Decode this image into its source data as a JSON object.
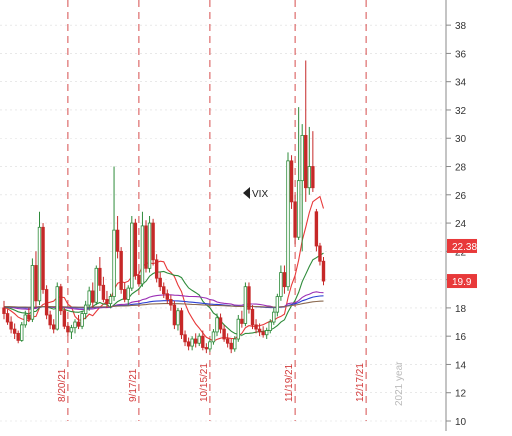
{
  "chart_data": {
    "type": "candlestick",
    "symbol": "VIX",
    "ylim": [
      10,
      39
    ],
    "y_ticks": [
      10,
      12,
      14,
      16,
      18,
      20,
      22,
      24,
      26,
      28,
      30,
      32,
      34,
      36,
      38
    ],
    "date_labels": [
      "8/20/21",
      "9/17/21",
      "10/15/21",
      "11/19/21",
      "12/17/21"
    ],
    "date_label_index": [
      18,
      38,
      58,
      82,
      102
    ],
    "year_label": "2021 year",
    "price_tags": [
      {
        "value": 22.38,
        "label": "22.38",
        "color": "#e8393a"
      },
      {
        "value": 19.9,
        "label": "19.9",
        "color": "#e8393a"
      }
    ],
    "candles": [
      [
        18.0,
        18.5,
        17.2,
        17.6
      ],
      [
        17.6,
        17.9,
        16.8,
        17.0
      ],
      [
        17.0,
        17.4,
        16.2,
        16.5
      ],
      [
        16.5,
        16.9,
        15.8,
        16.2
      ],
      [
        16.2,
        16.4,
        15.5,
        15.7
      ],
      [
        15.7,
        17.0,
        15.6,
        16.8
      ],
      [
        16.8,
        17.8,
        16.6,
        17.5
      ],
      [
        17.5,
        18.0,
        17.0,
        17.2
      ],
      [
        17.2,
        21.5,
        17.0,
        21.0
      ],
      [
        21.0,
        22.0,
        18.0,
        18.5
      ],
      [
        18.5,
        24.8,
        18.2,
        23.7
      ],
      [
        23.7,
        24.0,
        19.0,
        19.3
      ],
      [
        19.3,
        19.6,
        17.2,
        17.5
      ],
      [
        17.5,
        17.8,
        16.5,
        16.8
      ],
      [
        16.8,
        17.2,
        16.2,
        16.5
      ],
      [
        16.5,
        19.8,
        16.4,
        19.5
      ],
      [
        19.5,
        19.7,
        17.5,
        17.8
      ],
      [
        17.8,
        18.0,
        16.5,
        16.7
      ],
      [
        16.7,
        17.0,
        16.0,
        16.3
      ],
      [
        16.3,
        16.8,
        15.8,
        16.6
      ],
      [
        16.6,
        17.2,
        16.2,
        17.0
      ],
      [
        17.0,
        17.5,
        16.5,
        16.7
      ],
      [
        16.7,
        17.8,
        16.5,
        17.6
      ],
      [
        17.6,
        18.5,
        17.2,
        18.2
      ],
      [
        18.2,
        19.5,
        17.8,
        19.2
      ],
      [
        19.2,
        19.8,
        18.0,
        18.4
      ],
      [
        18.4,
        21.0,
        18.2,
        20.8
      ],
      [
        20.8,
        21.6,
        19.2,
        19.6
      ],
      [
        19.6,
        20.2,
        18.4,
        18.6
      ],
      [
        18.6,
        19.2,
        18.0,
        18.3
      ],
      [
        18.3,
        19.0,
        18.0,
        18.8
      ],
      [
        18.8,
        28.0,
        18.5,
        23.5
      ],
      [
        23.5,
        24.5,
        21.5,
        22.0
      ],
      [
        22.0,
        22.3,
        19.0,
        19.3
      ],
      [
        19.3,
        19.8,
        18.4,
        18.6
      ],
      [
        18.6,
        19.6,
        18.2,
        19.4
      ],
      [
        19.4,
        24.5,
        19.2,
        24.0
      ],
      [
        24.0,
        24.3,
        20.0,
        20.3
      ],
      [
        20.3,
        20.6,
        19.5,
        19.7
      ],
      [
        19.7,
        24.8,
        19.5,
        23.8
      ],
      [
        23.8,
        24.2,
        20.5,
        20.8
      ],
      [
        20.8,
        24.5,
        20.5,
        24.0
      ],
      [
        24.0,
        24.3,
        21.0,
        21.4
      ],
      [
        21.4,
        21.8,
        19.8,
        20.1
      ],
      [
        20.1,
        20.5,
        19.2,
        19.5
      ],
      [
        19.5,
        19.8,
        18.7,
        19.0
      ],
      [
        19.0,
        19.3,
        18.3,
        18.6
      ],
      [
        18.6,
        18.9,
        17.8,
        18.2
      ],
      [
        18.2,
        18.5,
        16.5,
        16.8
      ],
      [
        16.8,
        18.0,
        16.4,
        17.8
      ],
      [
        17.8,
        18.0,
        15.8,
        16.1
      ],
      [
        16.1,
        16.4,
        15.3,
        15.6
      ],
      [
        15.6,
        15.9,
        15.0,
        15.3
      ],
      [
        15.3,
        16.0,
        15.0,
        15.8
      ],
      [
        15.8,
        16.2,
        15.2,
        15.5
      ],
      [
        15.5,
        16.2,
        15.3,
        16.0
      ],
      [
        16.0,
        16.4,
        15.0,
        15.2
      ],
      [
        15.2,
        15.5,
        14.8,
        15.1
      ],
      [
        15.1,
        15.8,
        14.9,
        15.6
      ],
      [
        15.6,
        16.5,
        15.4,
        16.3
      ],
      [
        16.3,
        17.6,
        16.0,
        17.3
      ],
      [
        17.3,
        17.6,
        16.2,
        16.5
      ],
      [
        16.5,
        16.8,
        15.6,
        15.8
      ],
      [
        15.8,
        16.2,
        15.2,
        15.5
      ],
      [
        15.5,
        15.8,
        14.8,
        15.1
      ],
      [
        15.1,
        16.0,
        14.9,
        15.8
      ],
      [
        15.8,
        17.5,
        15.6,
        17.2
      ],
      [
        17.2,
        17.8,
        16.6,
        16.9
      ],
      [
        16.9,
        19.8,
        16.7,
        19.5
      ],
      [
        19.5,
        19.8,
        17.6,
        17.9
      ],
      [
        17.9,
        18.2,
        16.5,
        16.8
      ],
      [
        16.8,
        17.2,
        16.2,
        16.5
      ],
      [
        16.5,
        16.9,
        16.0,
        16.3
      ],
      [
        16.3,
        16.7,
        15.9,
        16.1
      ],
      [
        16.1,
        16.6,
        15.8,
        16.4
      ],
      [
        16.4,
        17.2,
        16.2,
        17.0
      ],
      [
        17.0,
        18.0,
        16.8,
        17.7
      ],
      [
        17.7,
        19.0,
        17.4,
        18.8
      ],
      [
        18.8,
        21.0,
        18.5,
        20.5
      ],
      [
        20.5,
        21.0,
        19.0,
        19.5
      ],
      [
        19.5,
        29.0,
        19.2,
        28.4
      ],
      [
        28.4,
        28.8,
        25.0,
        25.5
      ],
      [
        25.5,
        26.0,
        22.5,
        23.0
      ],
      [
        23.0,
        32.2,
        22.8,
        27.0
      ],
      [
        27.0,
        31.0,
        22.0,
        30.2
      ],
      [
        30.2,
        35.5,
        25.5,
        26.5
      ],
      [
        26.5,
        30.8,
        26.0,
        28.0
      ],
      [
        28.0,
        30.5,
        26.2,
        26.5
      ],
      [
        24.8,
        25.0,
        22.0,
        22.38
      ],
      [
        22.38,
        22.6,
        21.0,
        21.3
      ],
      [
        21.3,
        21.6,
        19.6,
        19.9
      ]
    ],
    "moving_averages": [
      {
        "color": "#e8393a",
        "period": 10
      },
      {
        "color": "#2e8b3a",
        "period": 20
      },
      {
        "color": "#9b2fb5",
        "period": 50
      },
      {
        "color": "#2b3fd1",
        "period": 100
      },
      {
        "color": "#8b6a50",
        "period": 200
      }
    ]
  }
}
